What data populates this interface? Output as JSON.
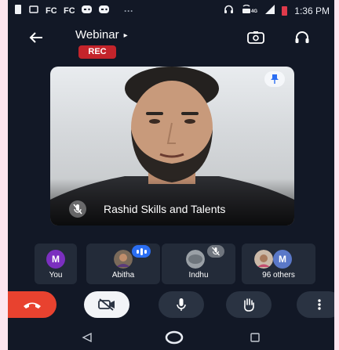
{
  "status_bar": {
    "time": "1:36 PM",
    "left_icons": [
      "notification-icon",
      "cast-icon",
      "fc-icon",
      "fc-icon",
      "game-icon",
      "game-icon",
      "more-dots-icon"
    ],
    "right_icons": [
      "headphones-icon",
      "volte-icon",
      "signal-icon",
      "battery-icon"
    ]
  },
  "header": {
    "title": "Webinar",
    "rec_badge": "REC",
    "back_icon": "back-arrow-icon",
    "switch_camera_icon": "switch-camera-icon",
    "audio_icon": "headphones-icon"
  },
  "main_tile": {
    "participant_name": "Rashid Skills and Talents",
    "muted": true,
    "pinned": true
  },
  "participants": [
    {
      "label": "You",
      "initial": "M",
      "color": "#7b2fbf"
    },
    {
      "label": "Abitha",
      "speaking": true
    },
    {
      "label": "Indhu",
      "muted": true
    },
    {
      "label": "96 others",
      "initial": "M",
      "color": "#5a78c8"
    }
  ],
  "controls": [
    "end-call-icon",
    "camera-off-icon",
    "microphone-icon",
    "raise-hand-icon",
    "more-options-icon"
  ],
  "colors": {
    "background": "#121826",
    "end_call": "#e8422f",
    "rec": "#c4242b",
    "speaking": "#2b6ef2"
  }
}
